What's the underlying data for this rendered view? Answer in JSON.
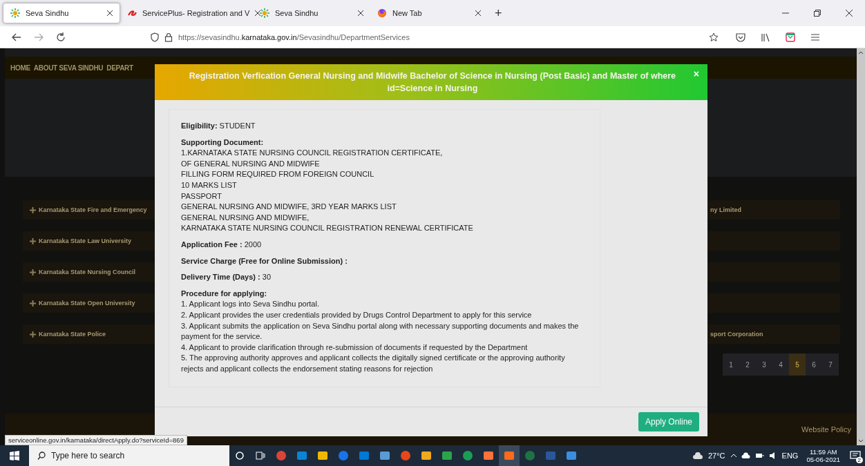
{
  "browser": {
    "tabs": [
      {
        "title": "Seva Sindhu",
        "selected": true
      },
      {
        "title": "ServicePlus- Registration and V",
        "selected": false
      },
      {
        "title": "Seva Sindhu",
        "selected": false
      },
      {
        "title": "New Tab",
        "selected": false
      }
    ],
    "new_tab": "+",
    "address": "https://sevasindhu.**karnataka.gov.in**/Sevasindhu/DepartmentServices"
  },
  "page": {
    "nav_items": [
      "HOME",
      "ABOUT SEVA SINDHU",
      "DEPART"
    ],
    "departments": [
      {
        "left": "Karnataka State Fire and Emergency",
        "right": "ny Limited"
      },
      {
        "left": "Karnataka State Law University"
      },
      {
        "left": "Karnataka State Nursing Council"
      },
      {
        "left": "Karnataka State Open University"
      },
      {
        "left": "Karnataka State Police",
        "right": "sport Corporation"
      }
    ],
    "pages": [
      {
        "label": "1",
        "selected": false
      },
      {
        "label": "2",
        "selected": false
      },
      {
        "label": "3",
        "selected": false
      },
      {
        "label": "4",
        "selected": false
      },
      {
        "label": "5",
        "selected": true
      },
      {
        "label": "6",
        "selected": false
      },
      {
        "label": "7",
        "selected": false
      }
    ],
    "footer_link": "Website Policy"
  },
  "modal": {
    "title": "Registration Verfication General Nursing and Midwife Bachelor of Science in Nursing (Post Basic) and Master of where id=Science in Nursing",
    "close": "×",
    "items": [
      {
        "kind": "inline",
        "label": "Eligibility:",
        "value": "STUDENT"
      },
      {
        "kind": "list",
        "label": "Supporting Document:",
        "lines": [
          "1.KARNATAKA STATE NURSING COUNCIL REGISTRATION CERTIFICATE,",
          "OF GENERAL NURSING AND MIDWIFE",
          "FILLING FORM REQUIRED FROM FOREIGN COUNCIL",
          "10 MARKS LIST",
          "PASSPORT",
          "GENERAL NURSING AND MIDWIFE, 3RD YEAR MARKS LIST",
          "GENERAL NURSING AND MIDWIFE,",
          "KARNATAKA STATE NURSING COUNCIL REGISTRATION RENEWAL CERTIFICATE"
        ]
      },
      {
        "kind": "inline",
        "label": "Application Fee :",
        "value": "2000"
      },
      {
        "kind": "inline",
        "label": "Service Charge (Free for Online Submission) :"
      },
      {
        "kind": "inline",
        "label": "Delivery Time (Days) :",
        "value": "30"
      },
      {
        "kind": "list",
        "label": "Procedure for applying:",
        "lines": [
          "1. Applicant logs into Seva Sindhu portal.",
          "2. Applicant provides the user credentials provided by Drugs Control Department to apply for this service",
          "3. Applicant submits the application on Seva Sindhu portal along with necessary supporting documents and makes the payment for the service.",
          "4. Applicant to provide clarification through re-submission of documents if requested by the Department",
          "5. The approving authority approves and applicant collects the digitally signed certificate or the approving authority rejects and applicant collects the endorsement stating reasons for rejection"
        ]
      }
    ],
    "button": "Apply Online"
  },
  "status_url": "serviceonline.gov.in/karnataka/directApply.do?serviceId=869",
  "taskbar": {
    "search_placeholder": "Type here to search",
    "temperature": "27°C",
    "language": "ENG",
    "time": "11:59 AM",
    "date": "05-06-2021",
    "notifications": "2"
  }
}
